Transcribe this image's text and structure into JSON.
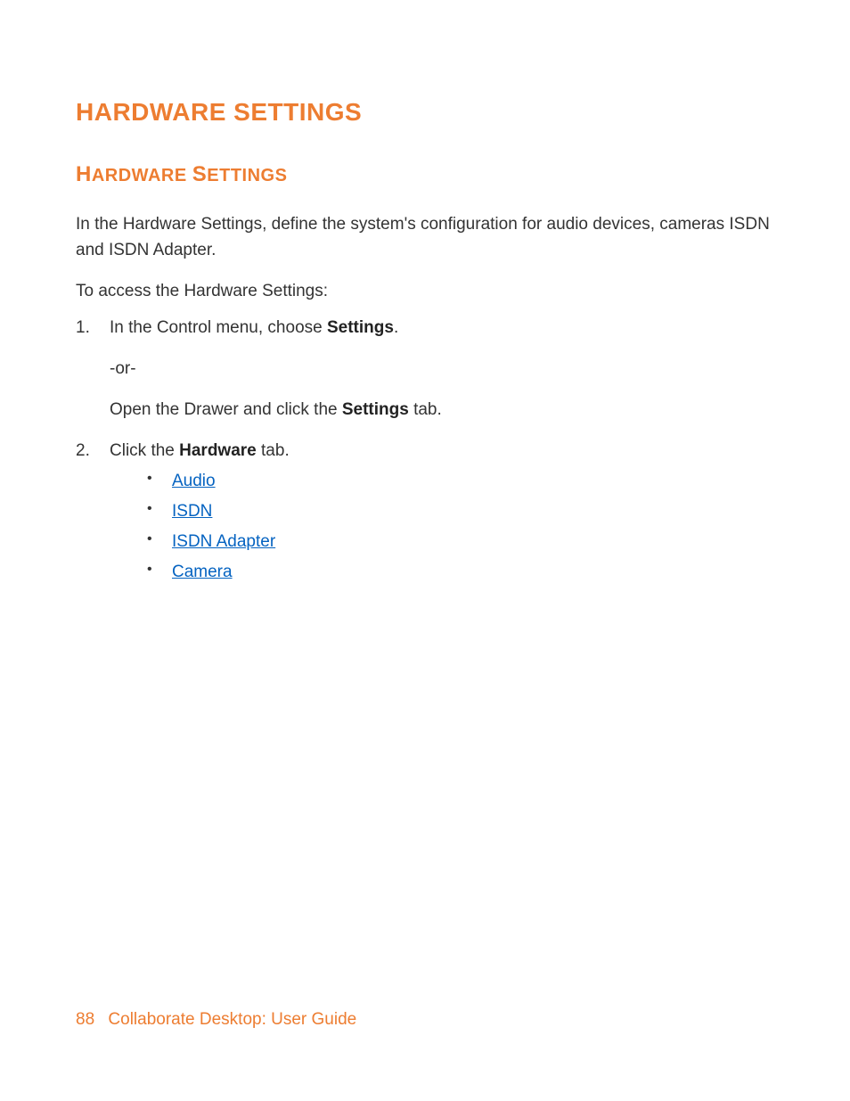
{
  "heading1": "HARDWARE SETTINGS",
  "heading2_leading": "H",
  "heading2_rest": "ARDWARE",
  "heading2_leading2": "S",
  "heading2_rest2": "ETTINGS",
  "intro": "In the Hardware Settings, define the system's configuration for audio devices, cameras ISDN and ISDN Adapter.",
  "access_line": "To access the Hardware Settings:",
  "step1_num": "1.",
  "step1_pre": "In the Control menu, choose ",
  "step1_bold": "Settings",
  "step1_post": ".",
  "or_text": "-or-",
  "drawer_pre": "Open the Drawer and click the ",
  "drawer_bold": "Settings",
  "drawer_post": " tab.",
  "step2_num": "2.",
  "step2_pre": "Click the ",
  "step2_bold": "Hardware",
  "step2_post": " tab.",
  "links": {
    "audio": "Audio",
    "isdn": "ISDN",
    "isdn_adapter": "ISDN Adapter",
    "camera": "Camera"
  },
  "footer": {
    "page_number": "88",
    "doc_title": "Collaborate Desktop: User Guide"
  }
}
